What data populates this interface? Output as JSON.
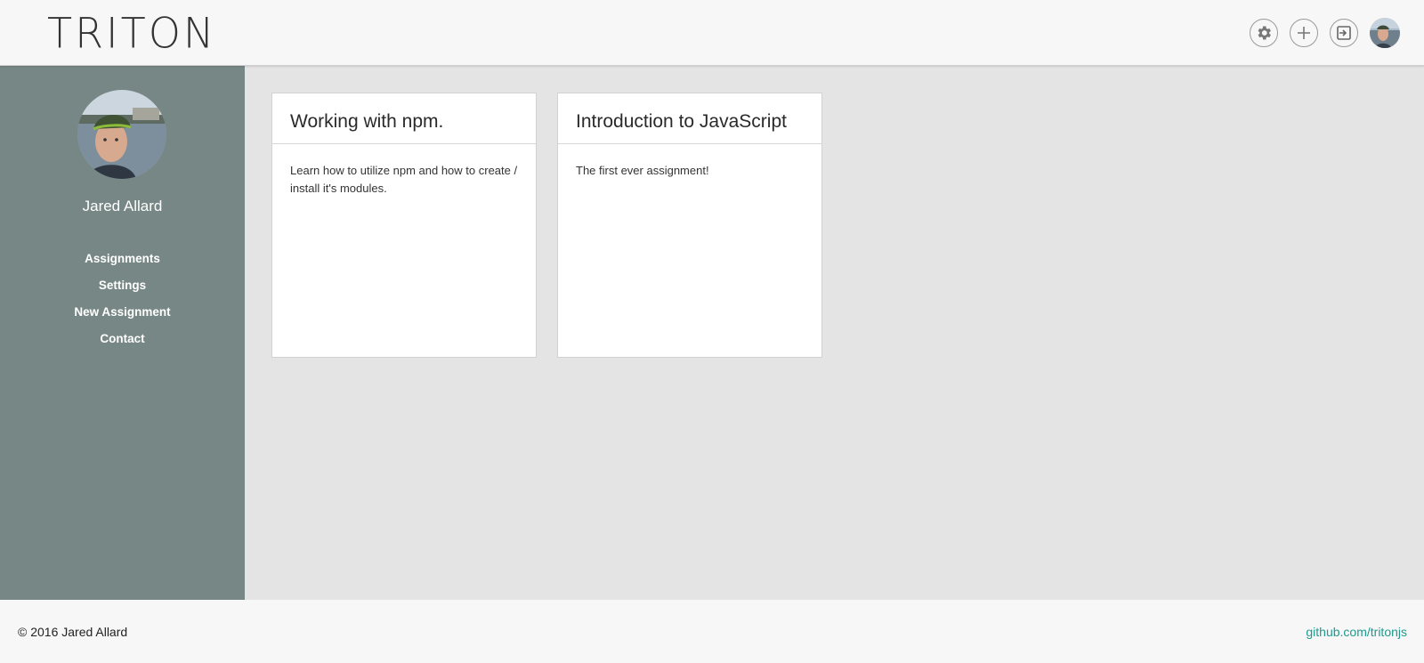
{
  "header": {
    "logo": "TRITON",
    "actions": [
      {
        "icon": "gear-icon",
        "label": "Settings"
      },
      {
        "icon": "plus-icon",
        "label": "New Assignment"
      },
      {
        "icon": "logout-icon",
        "label": "Log out"
      }
    ]
  },
  "sidebar": {
    "user_name": "Jared Allard",
    "nav": [
      "Assignments",
      "Settings",
      "New Assignment",
      "Contact"
    ]
  },
  "cards": [
    {
      "title": "Working with npm.",
      "description": "Learn how to utilize npm and how to create / install it's modules."
    },
    {
      "title": "Introduction to JavaScript",
      "description": "The first ever assignment!"
    }
  ],
  "footer": {
    "copyright": "© 2016 Jared Allard",
    "link": "github.com/tritonjs"
  },
  "colors": {
    "sidebar_bg": "#778785",
    "header_bg": "#f7f7f7",
    "main_bg": "#e4e4e4",
    "link": "#1e9a8e"
  }
}
